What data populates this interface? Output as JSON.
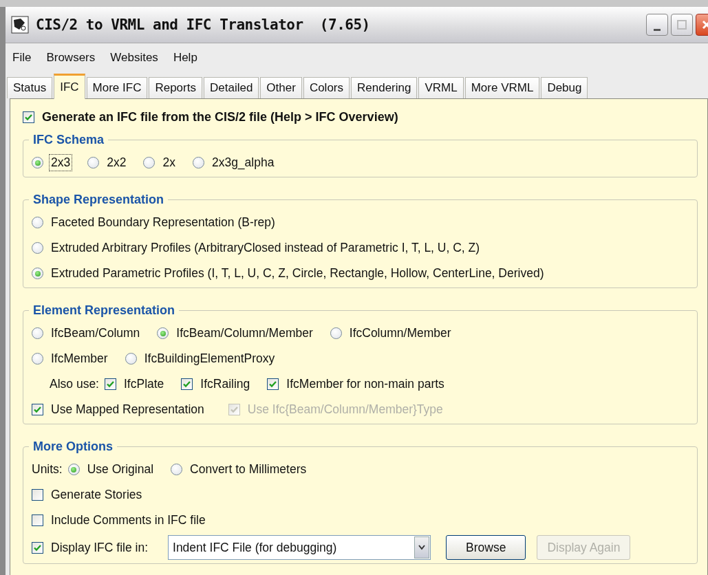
{
  "window": {
    "title": "CIS/2 to VRML and IFC Translator  (7.65)"
  },
  "menu": [
    "File",
    "Browsers",
    "Websites",
    "Help"
  ],
  "tabs": [
    {
      "label": "Status",
      "selected": false
    },
    {
      "label": "IFC",
      "selected": true
    },
    {
      "label": "More IFC",
      "selected": false
    },
    {
      "label": "Reports",
      "selected": false
    },
    {
      "label": "Detailed",
      "selected": false
    },
    {
      "label": "Other",
      "selected": false
    },
    {
      "label": "Colors",
      "selected": false
    },
    {
      "label": "Rendering",
      "selected": false
    },
    {
      "label": "VRML",
      "selected": false
    },
    {
      "label": "More VRML",
      "selected": false
    },
    {
      "label": "Debug",
      "selected": false
    }
  ],
  "generate_ifc": {
    "label": "Generate an IFC file from the CIS/2 file (Help > IFC Overview)",
    "checked": true
  },
  "ifc_schema": {
    "title": "IFC Schema",
    "options": [
      {
        "label": "2x3",
        "selected": true,
        "focused": true
      },
      {
        "label": "2x2",
        "selected": false,
        "focused": false
      },
      {
        "label": "2x",
        "selected": false,
        "focused": false
      },
      {
        "label": "2x3g_alpha",
        "selected": false,
        "focused": false
      }
    ]
  },
  "shape_representation": {
    "title": "Shape Representation",
    "options": [
      {
        "label": "Faceted Boundary Representation (B-rep)",
        "selected": false
      },
      {
        "label": "Extruded Arbitrary Profiles (ArbitraryClosed instead of Parametric I, T, L, U, C, Z)",
        "selected": false
      },
      {
        "label": "Extruded Parametric Profiles (I, T, L, U, C, Z, Circle, Rectangle, Hollow, CenterLine, Derived)",
        "selected": true
      }
    ]
  },
  "element_representation": {
    "title": "Element Representation",
    "option_rows": [
      [
        {
          "label": "IfcBeam/Column",
          "selected": false
        },
        {
          "label": "IfcBeam/Column/Member",
          "selected": true
        },
        {
          "label": "IfcColumn/Member",
          "selected": false
        }
      ],
      [
        {
          "label": "IfcMember",
          "selected": false
        },
        {
          "label": "IfcBuildingElementProxy",
          "selected": false
        }
      ]
    ],
    "also_use_label": "Also use:",
    "also_use": [
      {
        "label": "IfcPlate",
        "checked": true
      },
      {
        "label": "IfcRailing",
        "checked": true
      },
      {
        "label": "IfcMember for non-main parts",
        "checked": true
      }
    ],
    "mapped": [
      {
        "label": "Use Mapped Representation",
        "checked": true,
        "disabled": false
      },
      {
        "label": "Use Ifc{Beam/Column/Member}Type",
        "checked": true,
        "disabled": true
      }
    ]
  },
  "more_options": {
    "title": "More Options",
    "units_label": "Units:",
    "units": [
      {
        "label": "Use Original",
        "selected": true
      },
      {
        "label": "Convert to Millimeters",
        "selected": false
      }
    ],
    "checkboxes": [
      {
        "label": "Generate Stories",
        "checked": false
      },
      {
        "label": "Include Comments in IFC file",
        "checked": false
      }
    ],
    "display_ifc": {
      "label": "Display IFC file in:",
      "checked": true
    },
    "viewer": {
      "value": "Indent IFC File (for debugging)"
    },
    "buttons": [
      {
        "label": "Browse",
        "disabled": false
      },
      {
        "label": "Display Again",
        "disabled": true
      }
    ]
  }
}
